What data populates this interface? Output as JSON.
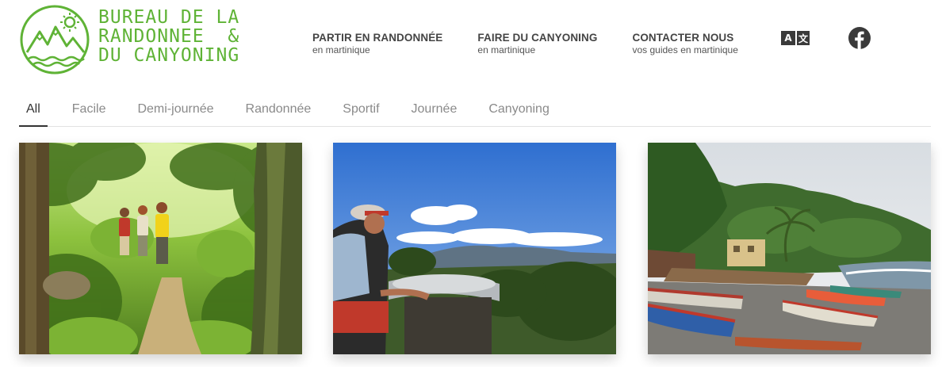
{
  "logo": {
    "lines": [
      "BUREAU DE LA",
      "RANDONNEE  &",
      "DU CANYONING"
    ],
    "color": "#5fb336",
    "icon": "mountain-sun-logo-icon"
  },
  "nav": {
    "items": [
      {
        "title": "PARTIR EN RANDONNÉE",
        "sub": "en martinique"
      },
      {
        "title": "FAIRE DU CANYONING",
        "sub": "en martinique"
      },
      {
        "title": "CONTACTER NOUS",
        "sub": "vos guides en martinique"
      }
    ],
    "translate_icon": "translate-icon",
    "translate_a": "A",
    "translate_z": "文",
    "facebook_icon": "facebook-icon"
  },
  "filters": {
    "items": [
      "All",
      "Facile",
      "Demi-journée",
      "Randonnée",
      "Sportif",
      "Journée",
      "Canyoning"
    ],
    "active": "All"
  },
  "gallery": {
    "images": [
      {
        "subject": "hikers-in-rainforest"
      },
      {
        "subject": "hiker-at-viewpoint"
      },
      {
        "subject": "fishing-boats-on-beach"
      }
    ]
  },
  "colors": {
    "brand_green": "#5fb336",
    "text_dark": "#444444",
    "text_muted": "#8a8a8a"
  }
}
